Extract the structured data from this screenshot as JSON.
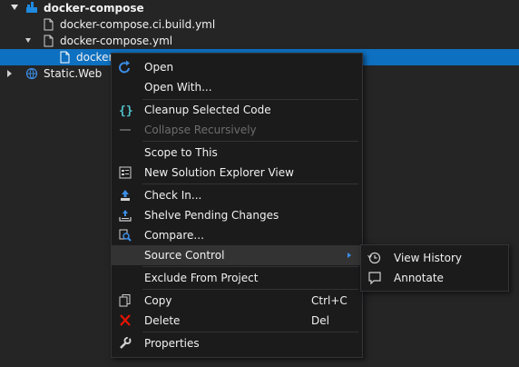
{
  "tree": {
    "items": [
      {
        "label": "docker-compose"
      },
      {
        "label": "docker-compose.ci.build.yml"
      },
      {
        "label": "docker-compose.yml"
      },
      {
        "label": "docker-compose.override.yml",
        "visible_label": "docker-"
      },
      {
        "label": "Static.Web"
      }
    ]
  },
  "context_menu": {
    "items": [
      {
        "label": "Open",
        "icon": "open-redo-icon"
      },
      {
        "label": "Open With..."
      },
      {
        "label": "Cleanup Selected Code",
        "icon": "braces-icon"
      },
      {
        "label": "Collapse Recursively",
        "icon": "collapse-icon",
        "disabled": true
      },
      {
        "label": "Scope to This"
      },
      {
        "label": "New Solution Explorer View",
        "icon": "solution-explorer-icon"
      },
      {
        "label": "Check In...",
        "icon": "check-in-icon"
      },
      {
        "label": "Shelve Pending Changes",
        "icon": "shelve-icon"
      },
      {
        "label": "Compare...",
        "icon": "compare-icon"
      },
      {
        "label": "Source Control",
        "has_submenu": true
      },
      {
        "label": "Exclude From Project"
      },
      {
        "label": "Copy",
        "shortcut": "Ctrl+C",
        "icon": "copy-icon"
      },
      {
        "label": "Delete",
        "shortcut": "Del",
        "icon": "delete-icon"
      },
      {
        "label": "Properties",
        "icon": "wrench-icon"
      }
    ]
  },
  "source_control_submenu": {
    "items": [
      {
        "label": "View History",
        "icon": "history-icon"
      },
      {
        "label": "Annotate",
        "icon": "annotate-icon"
      }
    ]
  },
  "colors": {
    "background": "#252526",
    "selection": "#0e70c0",
    "menu_bg": "#1b1b1c",
    "accent": "#3c8ee8",
    "delete_red": "#e51400"
  }
}
